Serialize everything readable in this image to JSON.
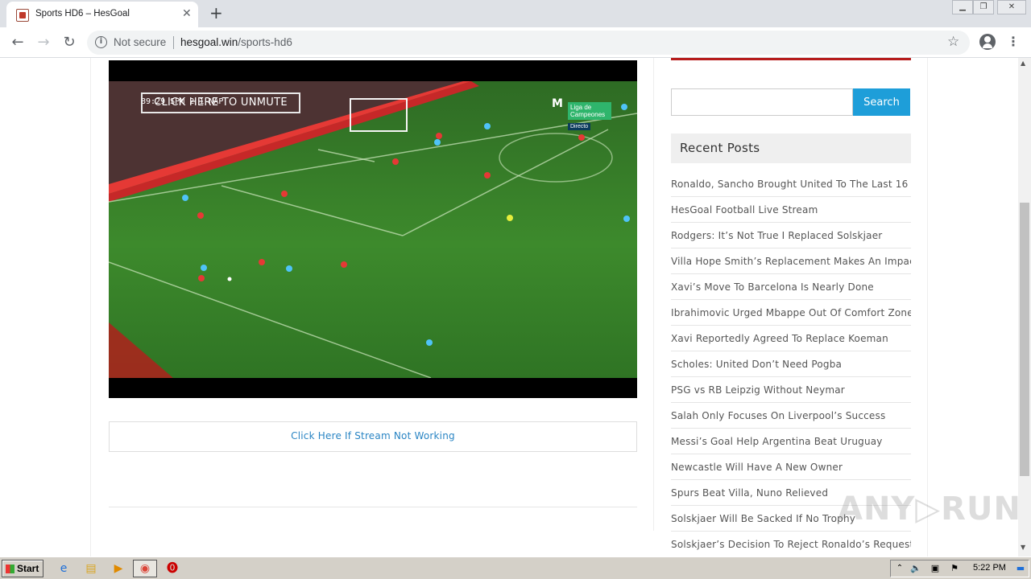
{
  "browser": {
    "tab_title": "Sports HD6 – HesGoal",
    "security_label": "Not secure",
    "url_host": "hesgoal.win",
    "url_path": "/sports-hd6",
    "new_tab_symbol": "+",
    "close_tab_symbol": "✕"
  },
  "video": {
    "unmute_label": "CLICK HERE TO UNMUTE",
    "scorebug": "89:29  SPM  2  1  NAP",
    "channel_label": "Liga de Campeones",
    "live_label": "Directo",
    "broadcaster_logo": "M"
  },
  "stream_link": "Click Here If Stream Not Working",
  "sidebar": {
    "search_button": "Search",
    "search_placeholder": "",
    "recent_posts_title": "Recent Posts",
    "posts": [
      "Ronaldo, Sancho Brought United To The Last 16",
      "HesGoal Football Live Stream",
      "Rodgers: It’s Not True I Replaced Solskjaer",
      "Villa Hope Smith’s Replacement Makes An Impact",
      "Xavi’s Move To Barcelona Is Nearly Done",
      "Ibrahimovic Urged Mbappe Out Of Comfort Zone",
      "Xavi Reportedly Agreed To Replace Koeman",
      "Scholes: United Don’t Need Pogba",
      "PSG vs RB Leipzig Without Neymar",
      "Salah Only Focuses On Liverpool’s Success",
      "Messi’s Goal Help Argentina Beat Uruguay",
      "Newcastle Will Have A New Owner",
      "Spurs Beat Villa, Nuno Relieved",
      "Solskjaer Will Be Sacked If No Trophy",
      "Solskjaer’s Decision To Reject Ronaldo’s Request"
    ]
  },
  "watermark": "ANY▷RUN",
  "taskbar": {
    "start_label": "Start",
    "clock": "5:22 PM"
  },
  "colors": {
    "accent": "#1e9ed9",
    "link": "#2a85c4",
    "brand_bar": "#b71c1c"
  }
}
